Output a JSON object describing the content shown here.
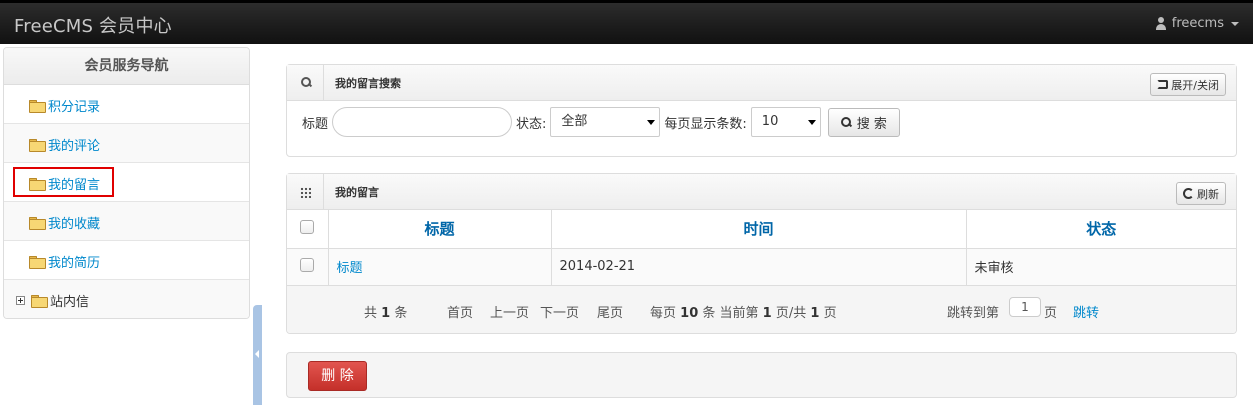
{
  "navbar": {
    "brand": "FreeCMS 会员中心",
    "user": "freecms",
    "icons": {
      "user": "user-icon",
      "caret": "caret-down-icon"
    }
  },
  "sidebar": {
    "title": "会员服务导航",
    "items": [
      {
        "label": "积分记录",
        "icon": "folder-icon"
      },
      {
        "label": "我的评论",
        "icon": "folder-icon"
      },
      {
        "label": "我的留言",
        "icon": "folder-icon",
        "highlighted": true
      },
      {
        "label": "我的收藏",
        "icon": "folder-icon"
      },
      {
        "label": "我的简历",
        "icon": "folder-icon"
      },
      {
        "label": "站内信",
        "icon": "folder-icon",
        "expandable": true
      }
    ]
  },
  "search_panel": {
    "title": "我的留言搜索",
    "toggle_label": "展开/关闭",
    "title_label": "标题",
    "title_value": "",
    "status_label": "状态:",
    "status_value": "全部",
    "page_size_label": "每页显示条数:",
    "page_size_value": "10",
    "search_label": "搜 索"
  },
  "list_panel": {
    "title": "我的留言",
    "refresh_label": "刷新",
    "columns": [
      "标题",
      "时间",
      "状态"
    ],
    "rows": [
      {
        "title": "标题",
        "time": "2014-02-21",
        "status": "未审核"
      }
    ]
  },
  "pager": {
    "total_prefix": "共",
    "total": "1",
    "total_suffix": "条",
    "first": "首页",
    "prev": "上一页",
    "next": "下一页",
    "last": "尾页",
    "per_page_prefix": "每页",
    "per_page": "10",
    "per_page_mid": "条 当前第",
    "current": "1",
    "page_total_mid": "页/共",
    "page_total": "1",
    "page_total_suffix": "页",
    "jump_prefix": "跳转到第",
    "jump_value": "1",
    "jump_suffix": "页",
    "jump_button": "跳转"
  },
  "actions": {
    "delete_label": "删 除"
  },
  "colors": {
    "navbar": "#1b1b1b",
    "link": "#0088cc",
    "header_text": "#0066a8",
    "delete_button": "#d2413a",
    "highlight": "#e00000"
  }
}
